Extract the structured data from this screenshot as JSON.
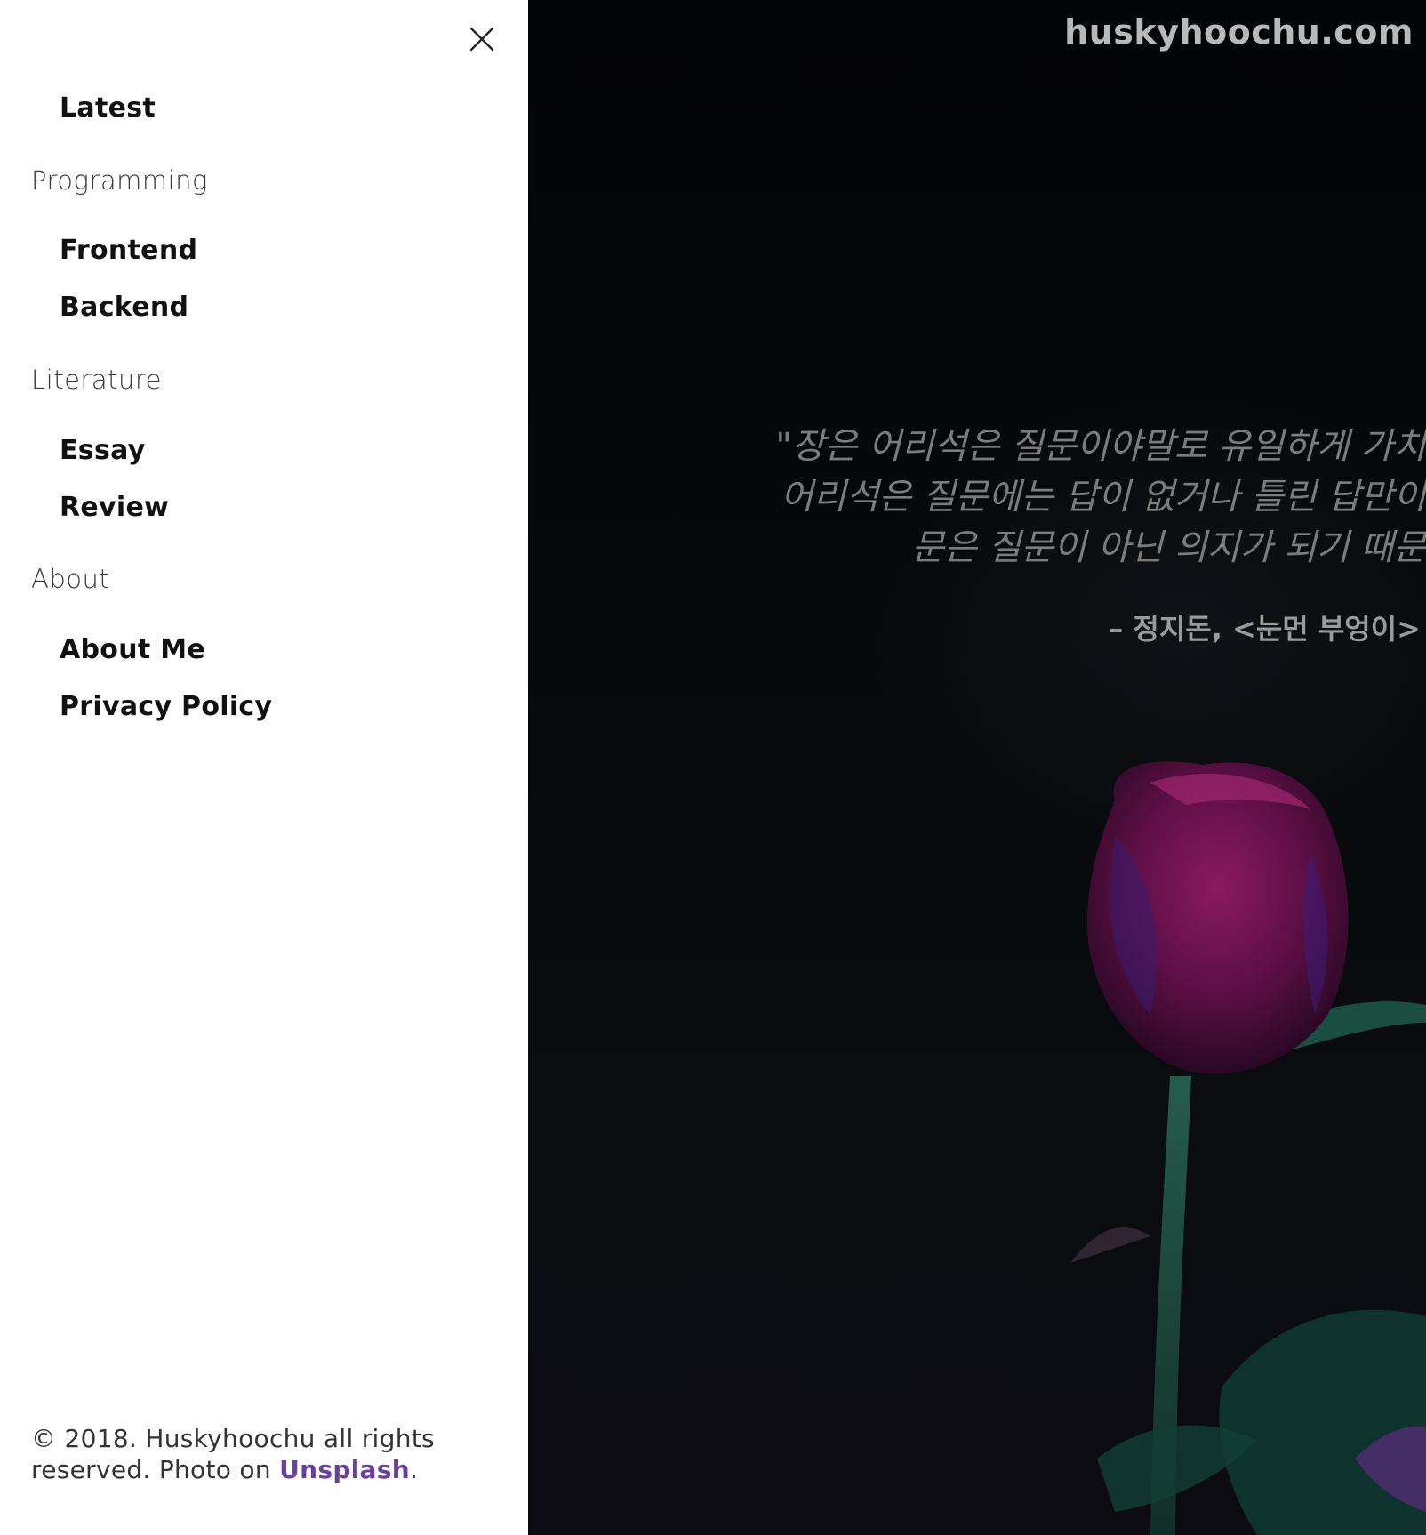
{
  "nav": {
    "close_label": "close",
    "items": [
      {
        "type": "link",
        "label": "Latest"
      },
      {
        "type": "section",
        "label": "Programming"
      },
      {
        "type": "link",
        "label": "Frontend"
      },
      {
        "type": "link",
        "label": "Backend"
      },
      {
        "type": "section",
        "label": "Literature"
      },
      {
        "type": "link",
        "label": "Essay"
      },
      {
        "type": "link",
        "label": "Review"
      },
      {
        "type": "section",
        "label": "About"
      },
      {
        "type": "link",
        "label": "About Me"
      },
      {
        "type": "link",
        "label": "Privacy Policy"
      }
    ]
  },
  "footer": {
    "copyright": "© 2018. Huskyhoochu all rights reserved. Photo on ",
    "link_label": "Unsplash",
    "trailing": "."
  },
  "hero": {
    "brand": "huskyhoochu.com",
    "quote_lines": [
      "\"장은 어리석은 질문이야말로 유일하게 가치 ",
      "어리석은 질문에는 답이 없거나 틀린 답만이 ",
      "문은 질문이 아닌 의지가 되기 때문"
    ],
    "attribution": "– 정지돈, <눈먼 부엉이>"
  },
  "colors": {
    "accent_link": "#6b3fa0",
    "drawer_bg": "#ffffff",
    "hero_bg": "#050608"
  },
  "icons": {
    "close": "close-icon",
    "rose": "rose-photo"
  }
}
